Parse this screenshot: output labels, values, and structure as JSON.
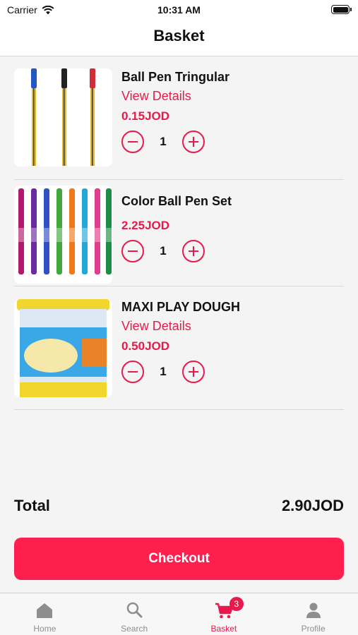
{
  "status_bar": {
    "carrier": "Carrier",
    "time": "10:31 AM"
  },
  "header": {
    "title": "Basket"
  },
  "items": [
    {
      "name": "Ball Pen Tringular",
      "details_link": "View Details",
      "price": "0.15JOD",
      "quantity": "1"
    },
    {
      "name": "Color Ball Pen Set",
      "price": "2.25JOD",
      "quantity": "1"
    },
    {
      "name": "MAXI PLAY DOUGH",
      "details_link": "View Details",
      "price": "0.50JOD",
      "quantity": "1"
    }
  ],
  "summary": {
    "total_label": "Total",
    "total_value": "2.90JOD"
  },
  "checkout_label": "Checkout",
  "tabs": [
    {
      "label": "Home",
      "icon": "home-icon"
    },
    {
      "label": "Search",
      "icon": "search-icon"
    },
    {
      "label": "Basket",
      "icon": "cart-icon",
      "badge": "3",
      "active": true
    },
    {
      "label": "Profile",
      "icon": "profile-icon"
    }
  ],
  "colors": {
    "accent": "#e8194b",
    "button": "#ff1f4f",
    "tab_inactive": "#8e8e8e"
  }
}
